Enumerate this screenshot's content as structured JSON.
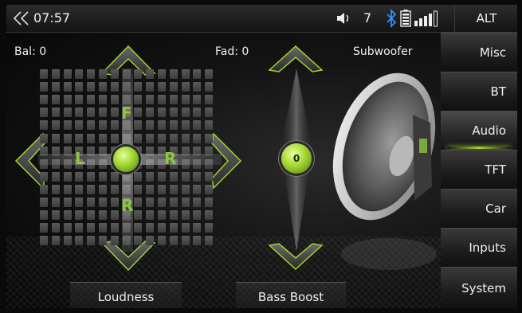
{
  "status": {
    "time": "07:57",
    "volume": "7",
    "alt_label": "ALT",
    "icons": [
      "back-chevron-icon",
      "speaker-volume-icon",
      "bluetooth-icon",
      "battery-icon",
      "signal-bars-icon"
    ]
  },
  "sidebar": {
    "items": [
      {
        "label": "Misc"
      },
      {
        "label": "BT"
      },
      {
        "label": "Audio",
        "active": true
      },
      {
        "label": "TFT"
      },
      {
        "label": "Car"
      },
      {
        "label": "Inputs"
      },
      {
        "label": "System"
      }
    ]
  },
  "audio": {
    "balance_label": "Bal: 0",
    "fader_label": "Fad: 0",
    "subwoofer_label": "Subwoofer",
    "pad_front": "F",
    "pad_left": "L",
    "pad_right": "R",
    "pad_rear": "R",
    "fader_value": "0",
    "loudness_label": "Loudness",
    "bass_boost_label": "Bass Boost"
  },
  "colors": {
    "accent": "#9fd42e",
    "letter": "#8cc63f"
  }
}
